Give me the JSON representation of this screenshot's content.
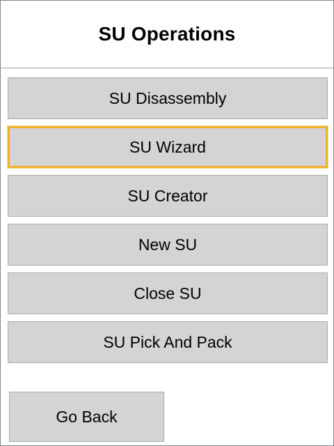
{
  "header": {
    "title": "SU Operations"
  },
  "menu": {
    "items": [
      {
        "label": "SU Disassembly"
      },
      {
        "label": "SU Wizard",
        "focused": true
      },
      {
        "label": "SU Creator"
      },
      {
        "label": "New SU"
      },
      {
        "label": "Close SU"
      },
      {
        "label": "SU Pick And Pack"
      }
    ]
  },
  "footer": {
    "back_label": "Go Back"
  },
  "colors": {
    "button_bg": "#d4d4d4",
    "focus_border": "#f0b030"
  }
}
